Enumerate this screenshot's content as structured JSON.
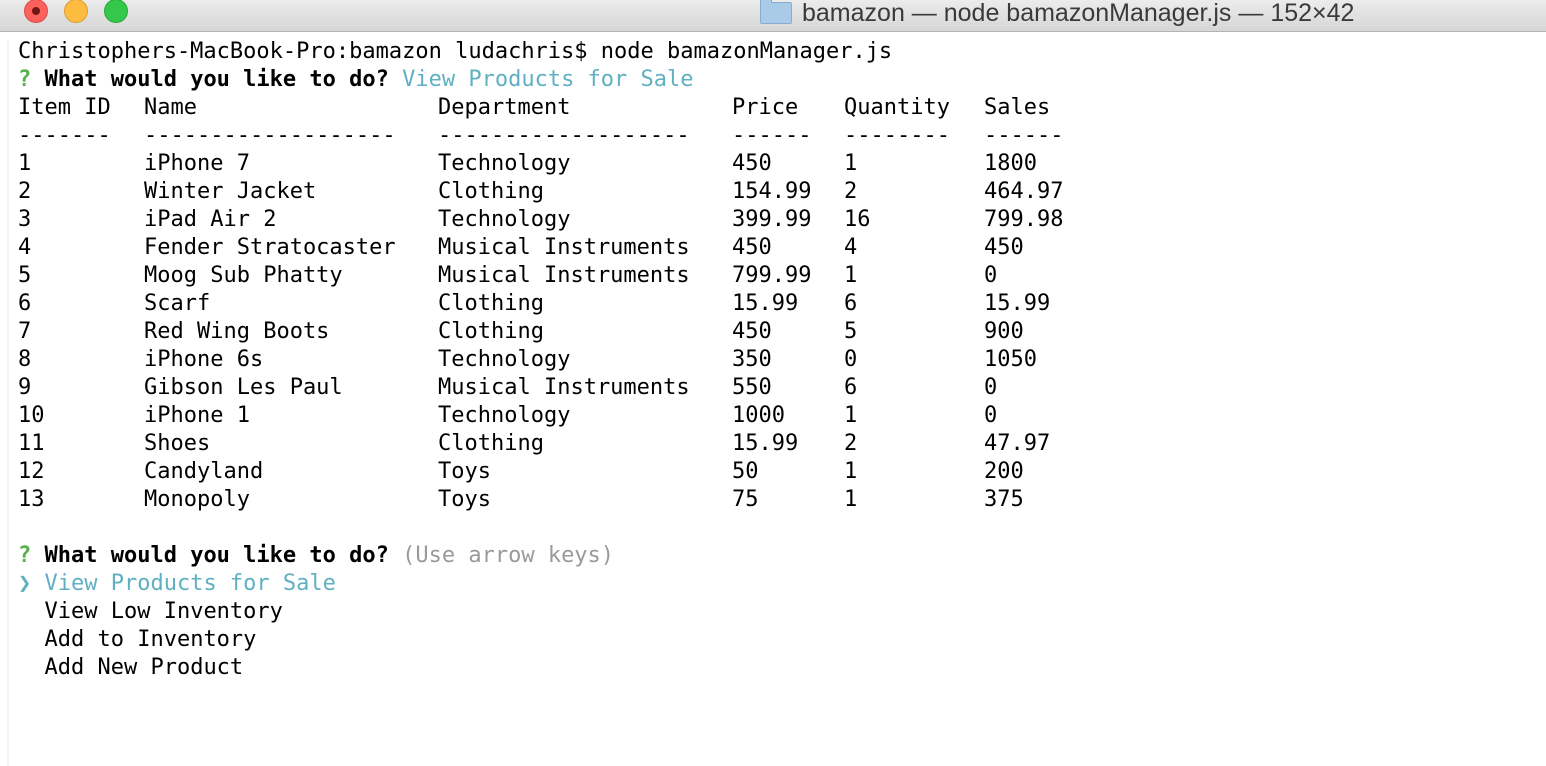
{
  "window": {
    "title": "bamazon — node bamazonManager.js — 152×42",
    "icon": "folder-icon",
    "colors": {
      "close": "#fc615d",
      "minimize": "#fdbc40",
      "maximize": "#34c84a"
    }
  },
  "terminal": {
    "command_line": "Christophers-MacBook-Pro:bamazon ludachris$ node bamazonManager.js",
    "prompt1": {
      "mark": "?",
      "question": "What would you like to do?",
      "answer": "View Products for Sale"
    },
    "table": {
      "headers": [
        "Item ID",
        "Name",
        "Department",
        "Price",
        "Quantity",
        "Sales"
      ],
      "dividers": [
        "-------",
        "-------------------",
        "-------------------",
        "------",
        "--------",
        "------"
      ],
      "rows": [
        [
          "1",
          "iPhone 7",
          "Technology",
          "450",
          "1",
          "1800"
        ],
        [
          "2",
          "Winter Jacket",
          "Clothing",
          "154.99",
          "2",
          "464.97"
        ],
        [
          "3",
          "iPad Air 2",
          "Technology",
          "399.99",
          "16",
          "799.98"
        ],
        [
          "4",
          "Fender Stratocaster",
          "Musical Instruments",
          "450",
          "4",
          "450"
        ],
        [
          "5",
          "Moog Sub Phatty",
          "Musical Instruments",
          "799.99",
          "1",
          "0"
        ],
        [
          "6",
          "Scarf",
          "Clothing",
          "15.99",
          "6",
          "15.99"
        ],
        [
          "7",
          "Red Wing Boots",
          "Clothing",
          "450",
          "5",
          "900"
        ],
        [
          "8",
          "iPhone 6s",
          "Technology",
          "350",
          "0",
          "1050"
        ],
        [
          "9",
          "Gibson Les Paul",
          "Musical Instruments",
          "550",
          "6",
          "0"
        ],
        [
          "10",
          "iPhone 1",
          "Technology",
          "1000",
          "1",
          "0"
        ],
        [
          "11",
          "Shoes",
          "Clothing",
          "15.99",
          "2",
          "47.97"
        ],
        [
          "12",
          "Candyland",
          "Toys",
          "50",
          "1",
          "200"
        ],
        [
          "13",
          "Monopoly",
          "Toys",
          "75",
          "1",
          "375"
        ]
      ]
    },
    "prompt2": {
      "mark": "?",
      "question": "What would you like to do?",
      "hint": "(Use arrow keys)"
    },
    "menu": {
      "pointer": "❯",
      "selected": "View Products for Sale",
      "options": [
        "View Low Inventory",
        "Add to Inventory",
        "Add New Product"
      ]
    },
    "colors": {
      "prompt_mark": "#55b24a",
      "answer": "#5fb0c2",
      "hint": "#9a9a9a"
    }
  }
}
